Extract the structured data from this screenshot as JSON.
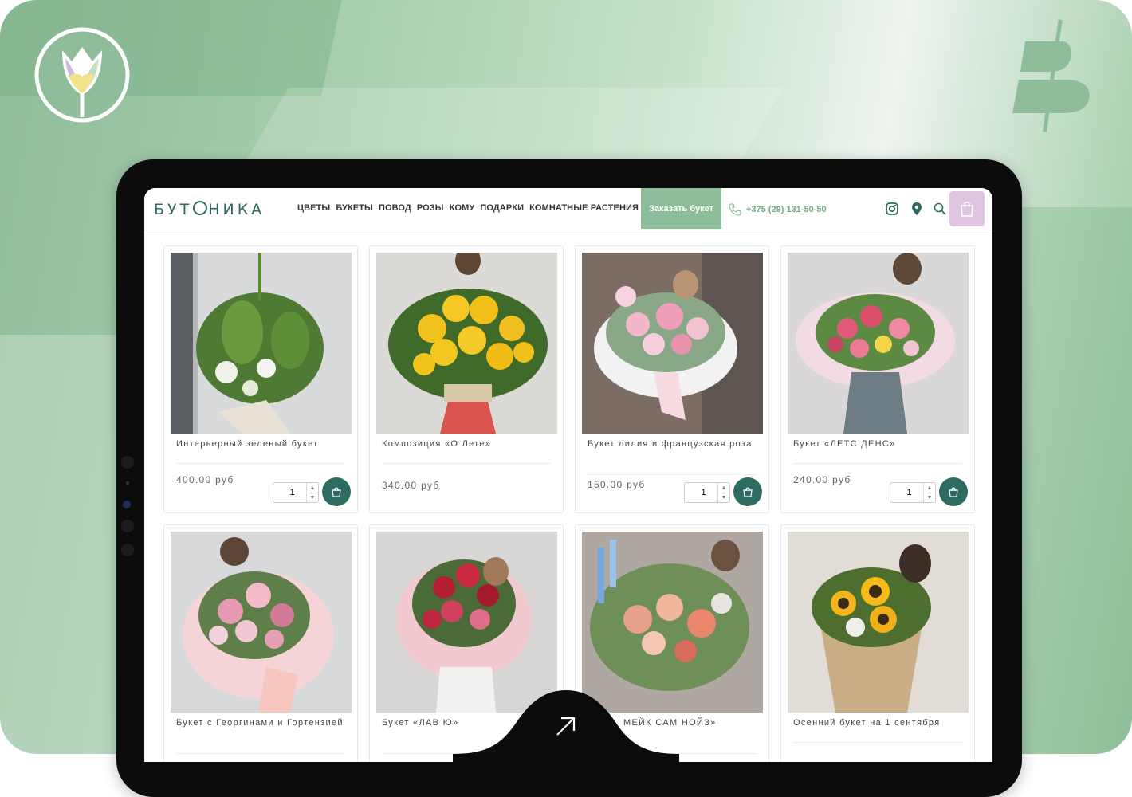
{
  "site": {
    "logo": "БУТ НИКА",
    "nav": [
      "ЦВЕТЫ",
      "БУКЕТЫ",
      "ПОВОД",
      "РОЗЫ",
      "КОМУ",
      "ПОДАРКИ",
      "КОМНАТНЫЕ РАСТЕНИЯ"
    ],
    "order_button": "Заказать букет",
    "phone": "+375 (29) 131-50-50",
    "icons": [
      "instagram-icon",
      "location-pin-icon",
      "search-icon",
      "shopping-bag-icon"
    ]
  },
  "colors": {
    "brand_green": "#2d6a5f",
    "accent_green": "#8dbd98",
    "cart_lilac": "#e0c5e3"
  },
  "products": [
    {
      "name": "Интерьерный зеленый букет",
      "price": "400.00 руб",
      "qty": "1"
    },
    {
      "name": "Композиция «О Лете»",
      "price": "340.00 руб",
      "qty": ""
    },
    {
      "name": "Букет лилия и французская роза",
      "price": "150.00 руб",
      "qty": "1"
    },
    {
      "name": "Букет «ЛЕТС ДЕНС»",
      "price": "240.00 руб",
      "qty": "1"
    },
    {
      "name": "Букет с Георгинами и Гортензией",
      "price": "",
      "qty": ""
    },
    {
      "name": "Букет «ЛАВ Ю»",
      "price": "",
      "qty": ""
    },
    {
      "name": "МЕЙК САМ НОЙЗ»",
      "price": "",
      "qty": ""
    },
    {
      "name": "Осенний букет на 1 сентября",
      "price": "",
      "qty": ""
    }
  ]
}
